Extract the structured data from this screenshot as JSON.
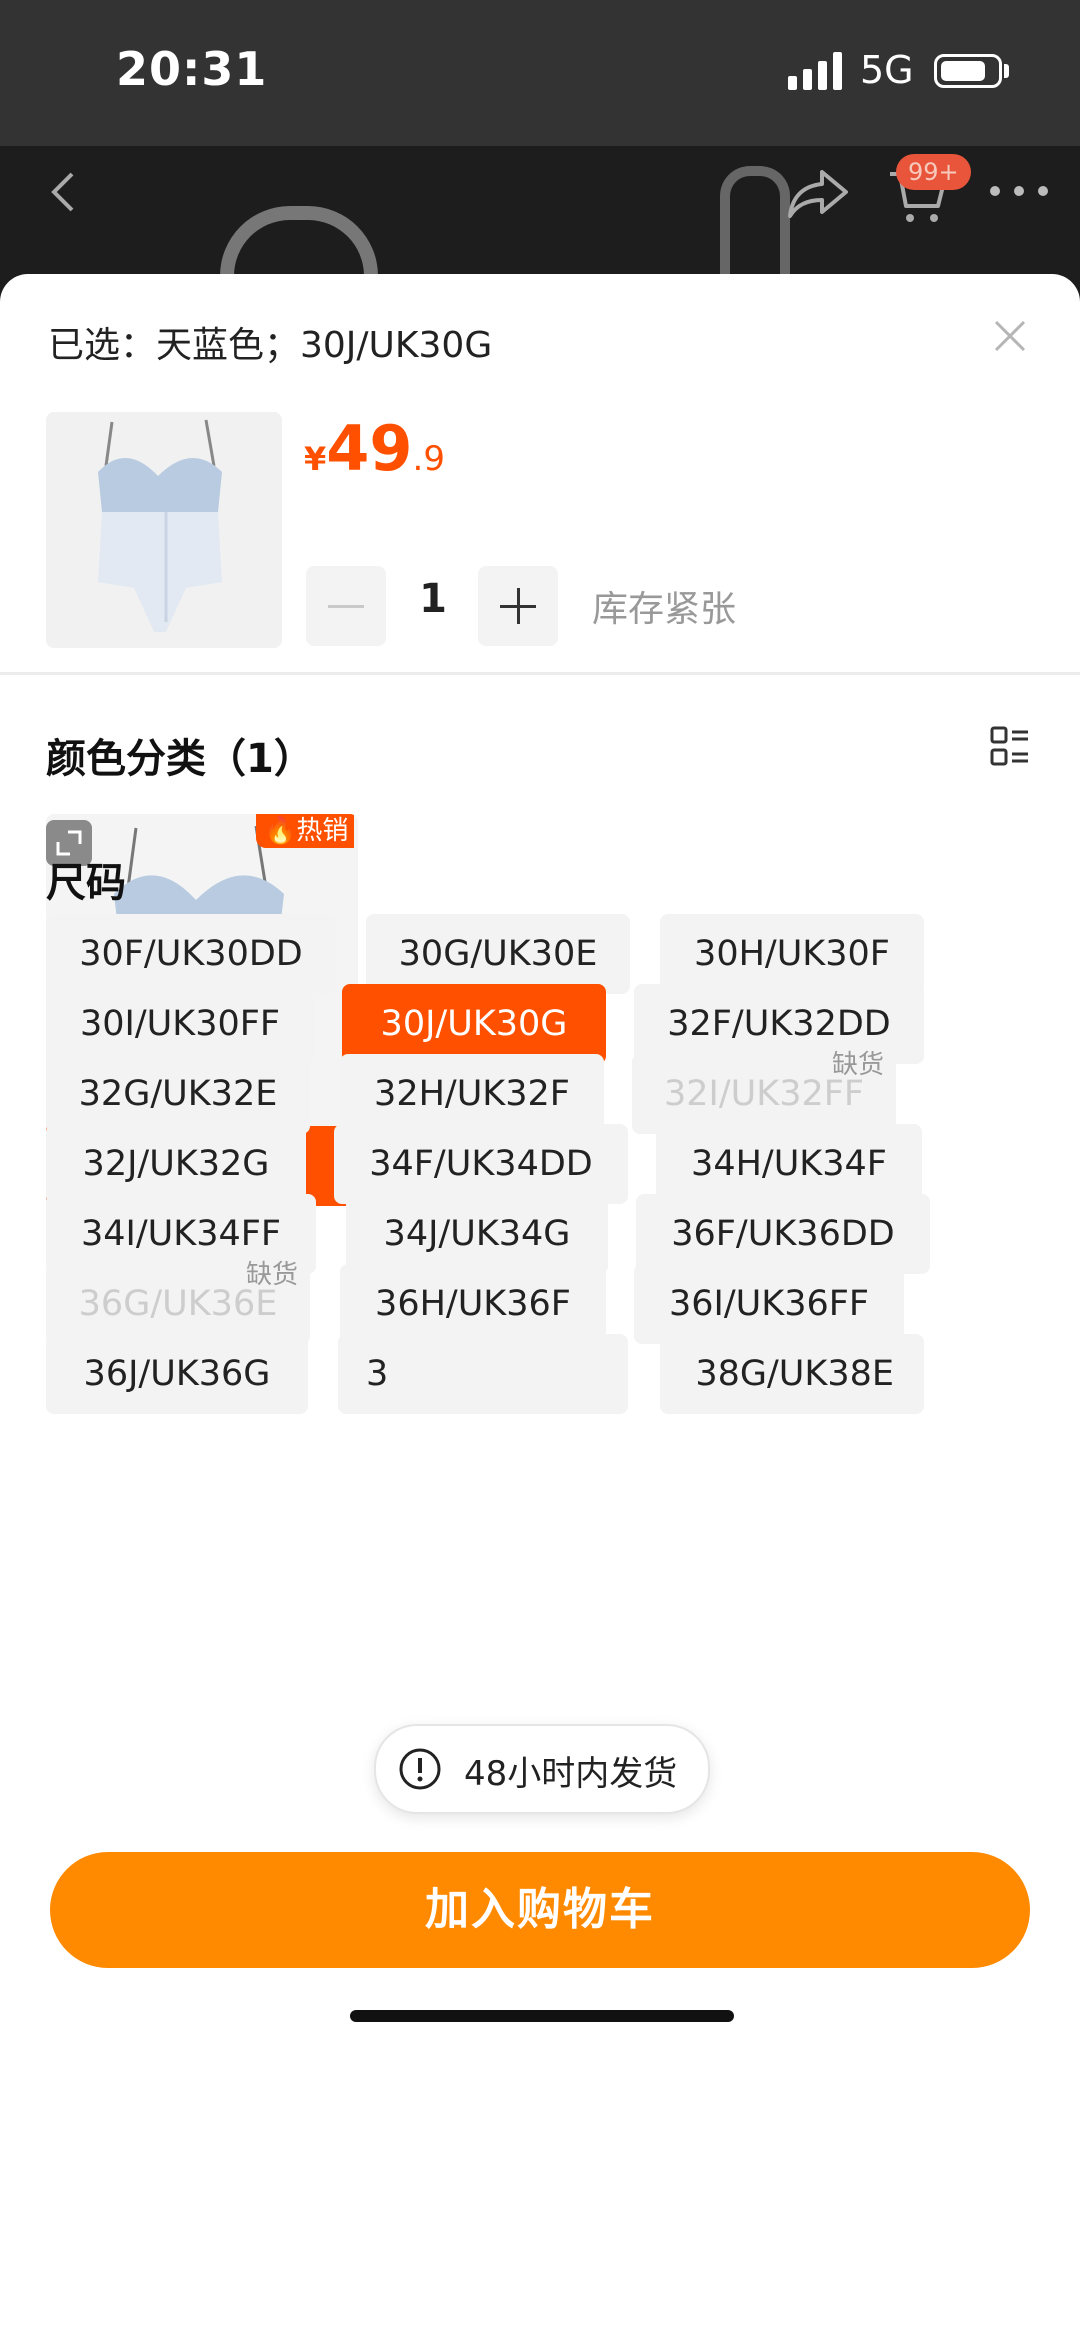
{
  "status_bar": {
    "time": "20:31",
    "network": "5G"
  },
  "header": {
    "cart_badge": "99+"
  },
  "sheet": {
    "selected_text": "已选：天蓝色；30J/UK30G",
    "price": {
      "currency": "¥",
      "integer": "49",
      "decimal": ".9"
    },
    "quantity": "1",
    "stock_status": "库存紧张"
  },
  "color_section": {
    "title": "颜色分类（1）",
    "options": [
      {
        "label": "天蓝色",
        "badge": "热销"
      }
    ]
  },
  "size_section": {
    "title": "尺码",
    "soldout_label": "缺货",
    "options": [
      {
        "label": "30F/UK30DD",
        "state": "normal"
      },
      {
        "label": "30G/UK30E",
        "state": "normal"
      },
      {
        "label": "30H/UK30F",
        "state": "normal"
      },
      {
        "label": "30I/UK30FF",
        "state": "normal"
      },
      {
        "label": "30J/UK30G",
        "state": "selected"
      },
      {
        "label": "32F/UK32DD",
        "state": "normal"
      },
      {
        "label": "32G/UK32E",
        "state": "normal"
      },
      {
        "label": "32H/UK32F",
        "state": "normal"
      },
      {
        "label": "32I/UK32FF",
        "state": "soldout"
      },
      {
        "label": "32J/UK32G",
        "state": "normal"
      },
      {
        "label": "34F/UK34DD",
        "state": "normal"
      },
      {
        "label": "34H/UK34F",
        "state": "normal"
      },
      {
        "label": "34I/UK34FF",
        "state": "normal"
      },
      {
        "label": "34J/UK34G",
        "state": "normal"
      },
      {
        "label": "36F/UK36DD",
        "state": "normal"
      },
      {
        "label": "36G/UK36E",
        "state": "soldout"
      },
      {
        "label": "36H/UK36F",
        "state": "normal"
      },
      {
        "label": "36I/UK36FF",
        "state": "normal"
      },
      {
        "label": "36J/UK36G",
        "state": "normal"
      },
      {
        "label": "3",
        "state": "normal"
      },
      {
        "label": "38G/UK38E",
        "state": "normal"
      }
    ]
  },
  "toast": {
    "text": "48小时内发货"
  },
  "footer": {
    "add_to_cart": "加入购物车"
  },
  "colors": {
    "accent": "#ff5000",
    "cta": "#ff8a00"
  }
}
